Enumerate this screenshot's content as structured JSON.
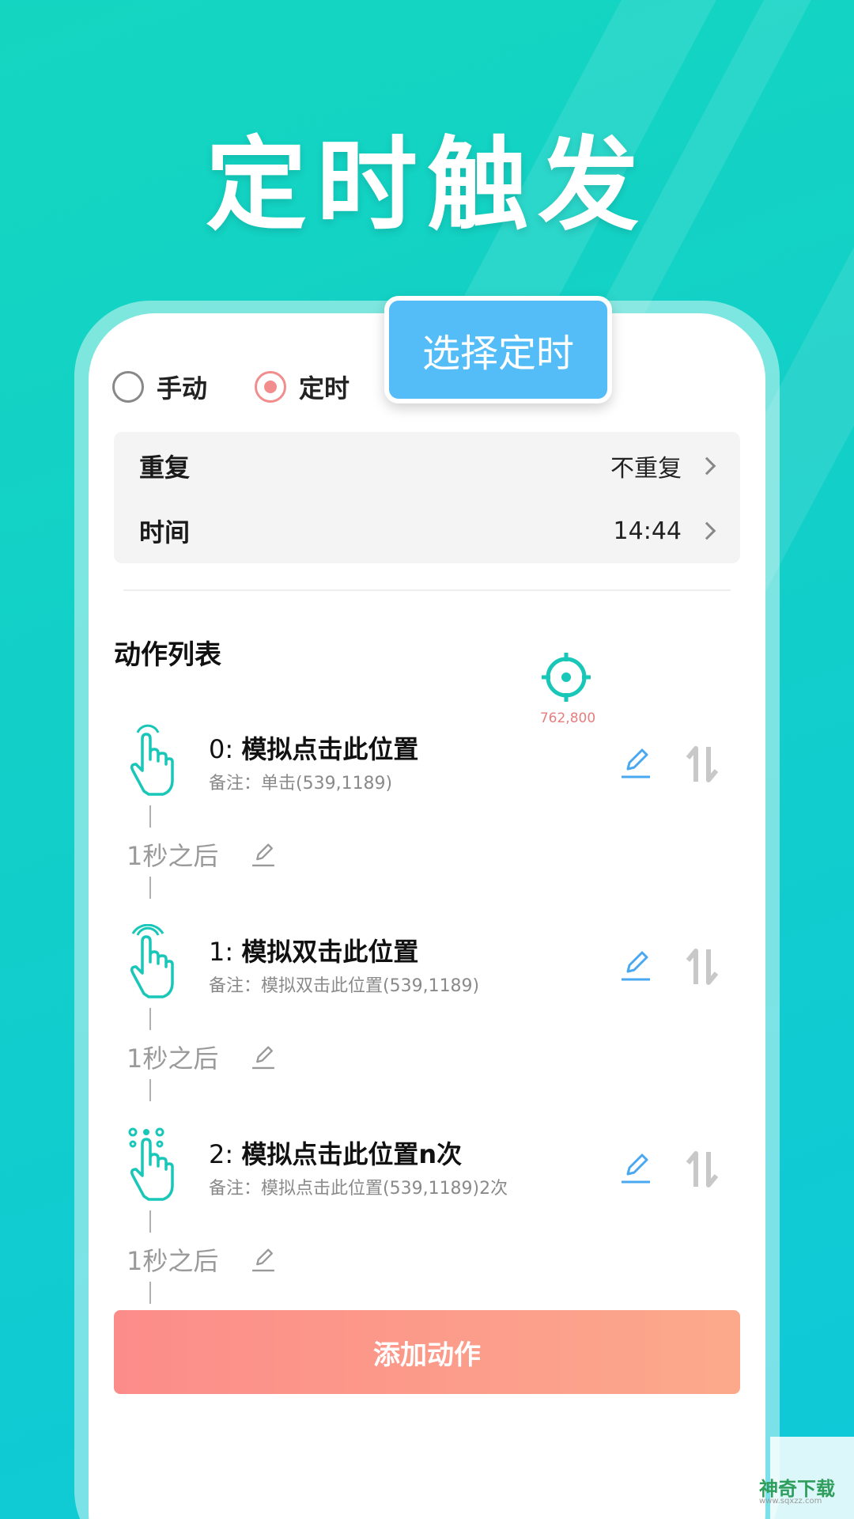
{
  "hero": {
    "title": "定时触发"
  },
  "callout": {
    "label": "选择定时"
  },
  "mode": {
    "manual_label": "手动",
    "timed_label": "定时",
    "selected": "定时"
  },
  "settings": {
    "repeat": {
      "label": "重复",
      "value": "不重复"
    },
    "time": {
      "label": "时间",
      "value": "14:44"
    }
  },
  "actions_section": {
    "title": "动作列表"
  },
  "target": {
    "coord": "762,800"
  },
  "actions": [
    {
      "index": "0:",
      "name": "模拟点击此位置",
      "note": "备注：单击(539,1189)",
      "delay": "1秒之后"
    },
    {
      "index": "1:",
      "name": "模拟双击此位置",
      "note": "备注：模拟双击此位置(539,1189)",
      "delay": "1秒之后"
    },
    {
      "index": "2:",
      "name": "模拟点击此位置n次",
      "note": "备注：模拟点击此位置(539,1189)2次",
      "delay": "1秒之后"
    }
  ],
  "add_button": {
    "label": "添加动作"
  },
  "watermark": {
    "text": "神奇下载",
    "sub": "www.sqxzz.com"
  },
  "colors": {
    "accent": "#14d6c0",
    "radio_on": "#f28d8d",
    "edit_blue": "#4aa8f0",
    "teal_icon": "#19c7b8"
  }
}
